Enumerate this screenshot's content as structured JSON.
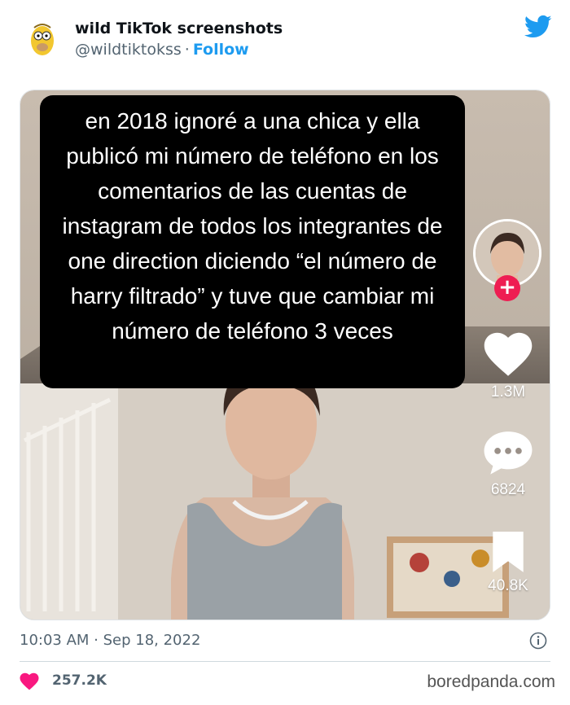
{
  "tweet": {
    "author_name": "wild TikTok screenshots",
    "handle": "@wildtiktokss",
    "separator": "·",
    "follow_label": "Follow",
    "timestamp": "10:03 AM · Sep 18, 2022",
    "like_count": "257.2K"
  },
  "tiktok": {
    "caption": "en 2018 ignoré a una chica y ella publicó mi número de teléfono en los comentarios de las cuentas de instagram de todos los integrantes de one direction diciendo “el número de harry filtrado” y tuve que cambiar mi número de teléfono 3 veces",
    "follow_plus": "+",
    "likes": "1.3M",
    "comments": "6824",
    "bookmarks": "40.8K"
  },
  "watermark": "boredpanda.com",
  "colors": {
    "accent": "#1d9bf0",
    "like_pink": "#f91880",
    "tiktok_red": "#ee1d52",
    "text_secondary": "#536471"
  },
  "icons": {
    "platform": "twitter-bird-icon",
    "info": "info-icon",
    "like": "heart-icon",
    "tt_like": "heart-icon",
    "tt_comment": "comment-bubble-icon",
    "tt_bookmark": "bookmark-icon"
  }
}
